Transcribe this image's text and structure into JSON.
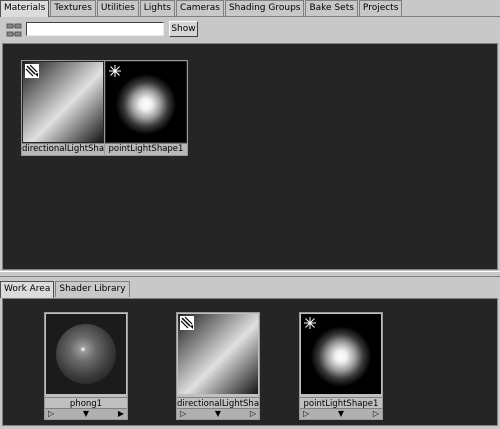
{
  "top_tabs": [
    "Materials",
    "Textures",
    "Utilities",
    "Lights",
    "Cameras",
    "Shading Groups",
    "Bake Sets",
    "Projects"
  ],
  "toolbar": {
    "search_value": "",
    "show_label": "Show"
  },
  "top_swatches": [
    {
      "label": "directionalLightSha...",
      "type": "directional-light"
    },
    {
      "label": "pointLightShape1",
      "type": "point-light"
    }
  ],
  "bottom_tabs": [
    "Work Area",
    "Shader Library"
  ],
  "work_nodes": [
    {
      "label": "phong1",
      "type": "phong-material"
    },
    {
      "label": "directionalLightSha...",
      "type": "directional-light"
    },
    {
      "label": "pointLightShape1",
      "type": "point-light"
    }
  ],
  "icons": {
    "directional": "directional-light-icon",
    "point": "point-light-icon",
    "arrow_left": "▷",
    "arrow_down": "▼",
    "arrow_right": "▶"
  }
}
